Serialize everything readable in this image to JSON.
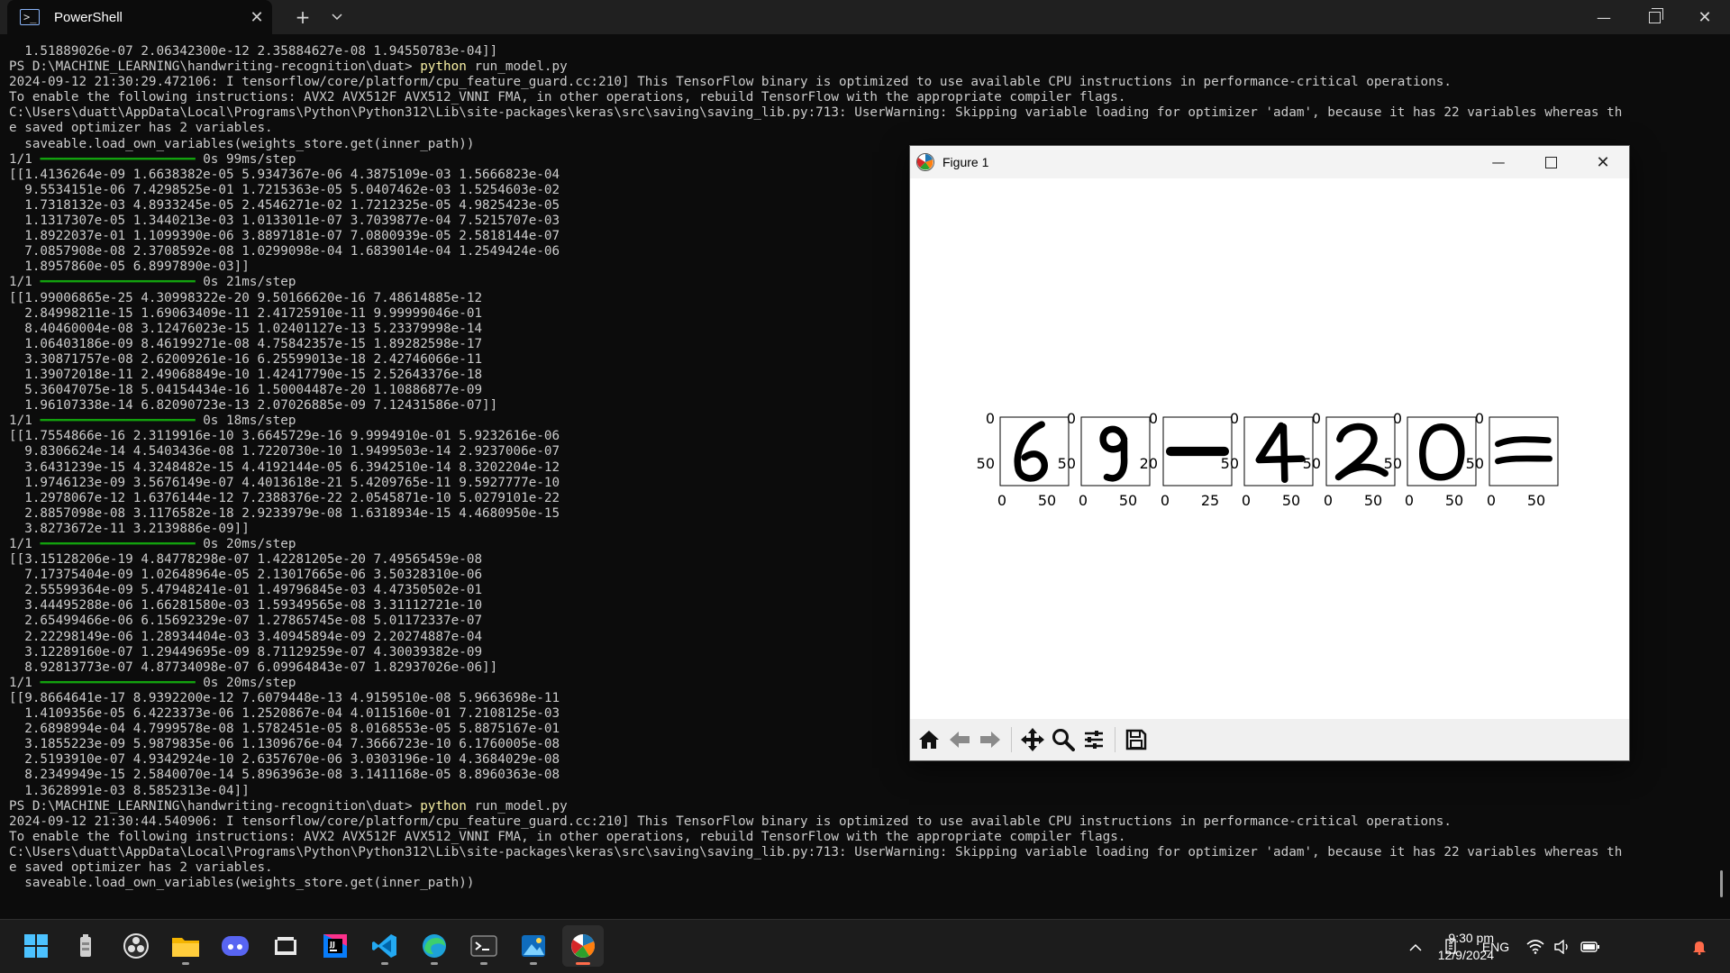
{
  "terminal": {
    "tab_title": "PowerShell",
    "tab_icon": "powershell-icon",
    "new_tab_label": "+",
    "dropdown_label": "⌄",
    "lines": [
      {
        "t": "  1.51889026e-07 2.06342300e-12 2.35884627e-08 1.94550783e-04]]"
      },
      {
        "t": "PS D:\\MACHINE_LEARNING\\handwriting-recognition\\duat> ",
        "cmd": "python",
        "rest": " run_model.py"
      },
      {
        "t": "2024-09-12 21:30:29.472106: I tensorflow/core/platform/cpu_feature_guard.cc:210] This TensorFlow binary is optimized to use available CPU instructions in performance-critical operations."
      },
      {
        "t": "To enable the following instructions: AVX2 AVX512F AVX512_VNNI FMA, in other operations, rebuild TensorFlow with the appropriate compiler flags."
      },
      {
        "t": "C:\\Users\\duatt\\AppData\\Local\\Programs\\Python\\Python312\\Lib\\site-packages\\keras\\src\\saving\\saving_lib.py:713: UserWarning: Skipping variable loading for optimizer 'adam', because it has 22 variables whereas th"
      },
      {
        "t": "e saved optimizer has 2 variables."
      },
      {
        "t": "  saveable.load_own_variables(weights_store.get(inner_path))"
      },
      {
        "t": "1/1 ",
        "bar": "━━━━━━━━━━━━━━━━━━━━",
        "rest": " 0s 99ms/step"
      },
      {
        "t": "[[1.4136264e-09 1.6638382e-05 5.9347367e-06 4.3875109e-03 1.5666823e-04"
      },
      {
        "t": "  9.5534151e-06 7.4298525e-01 1.7215363e-05 5.0407462e-03 1.5254603e-02"
      },
      {
        "t": "  1.7318132e-03 4.8933245e-05 2.4546271e-02 1.7212325e-05 4.9825423e-05"
      },
      {
        "t": "  1.1317307e-05 1.3440213e-03 1.0133011e-07 3.7039877e-04 7.5215707e-03"
      },
      {
        "t": "  1.8922037e-01 1.1099390e-06 3.8897181e-07 7.0800939e-05 2.5818144e-07"
      },
      {
        "t": "  7.0857908e-08 2.3708592e-08 1.0299098e-04 1.6839014e-04 1.2549424e-06"
      },
      {
        "t": "  1.8957860e-05 6.8997890e-03]]"
      },
      {
        "t": "1/1 ",
        "bar": "━━━━━━━━━━━━━━━━━━━━",
        "rest": " 0s 21ms/step"
      },
      {
        "t": "[[1.99006865e-25 4.30998322e-20 9.50166620e-16 7.48614885e-12"
      },
      {
        "t": "  2.84998211e-15 1.69063409e-11 2.41725910e-11 9.99999046e-01"
      },
      {
        "t": "  8.40460004e-08 3.12476023e-15 1.02401127e-13 5.23379998e-14"
      },
      {
        "t": "  1.06403186e-09 8.46199271e-08 4.75842357e-15 1.89282598e-17"
      },
      {
        "t": "  3.30871757e-08 2.62009261e-16 6.25599013e-18 2.42746066e-11"
      },
      {
        "t": "  1.39072018e-11 2.49068849e-10 1.42417790e-15 2.52643376e-18"
      },
      {
        "t": "  5.36047075e-18 5.04154434e-16 1.50004487e-20 1.10886877e-09"
      },
      {
        "t": "  1.96107338e-14 6.82090723e-13 2.07026885e-09 7.12431586e-07]]"
      },
      {
        "t": "1/1 ",
        "bar": "━━━━━━━━━━━━━━━━━━━━",
        "rest": " 0s 18ms/step"
      },
      {
        "t": "[[1.7554866e-16 2.3119916e-10 3.6645729e-16 9.9994910e-01 5.9232616e-06"
      },
      {
        "t": "  9.8306624e-14 4.5403436e-08 1.7220730e-10 1.9499503e-14 2.9237006e-07"
      },
      {
        "t": "  3.6431239e-15 4.3248482e-15 4.4192144e-05 6.3942510e-14 8.3202204e-12"
      },
      {
        "t": "  1.9746123e-09 3.5676149e-07 4.4013618e-21 5.4209765e-11 9.5927777e-10"
      },
      {
        "t": "  1.2978067e-12 1.6376144e-12 7.2388376e-22 2.0545871e-10 5.0279101e-22"
      },
      {
        "t": "  2.8857098e-08 3.1176582e-18 2.9233979e-08 1.6318934e-15 4.4680950e-15"
      },
      {
        "t": "  3.8273672e-11 3.2139886e-09]]"
      },
      {
        "t": "1/1 ",
        "bar": "━━━━━━━━━━━━━━━━━━━━",
        "rest": " 0s 20ms/step"
      },
      {
        "t": "[[3.15128206e-19 4.84778298e-07 1.42281205e-20 7.49565459e-08"
      },
      {
        "t": "  7.17375404e-09 1.02648964e-05 2.13017665e-06 3.50328310e-06"
      },
      {
        "t": "  2.55599364e-09 5.47948241e-01 1.49796845e-03 4.47350502e-01"
      },
      {
        "t": "  3.44495288e-06 1.66281580e-03 1.59349565e-08 3.31112721e-10"
      },
      {
        "t": "  2.65499466e-06 6.15692329e-07 1.27865745e-08 5.01172337e-07"
      },
      {
        "t": "  2.22298149e-06 1.28934404e-03 3.40945894e-09 2.20274887e-04"
      },
      {
        "t": "  3.12289160e-07 1.29449695e-09 8.71129259e-07 4.30039382e-09"
      },
      {
        "t": "  8.92813773e-07 4.87734098e-07 6.09964843e-07 1.82937026e-06]]"
      },
      {
        "t": "1/1 ",
        "bar": "━━━━━━━━━━━━━━━━━━━━",
        "rest": " 0s 20ms/step"
      },
      {
        "t": "[[9.8664641e-17 8.9392200e-12 7.6079448e-13 4.9159510e-08 5.9663698e-11"
      },
      {
        "t": "  1.4109356e-05 6.4223373e-06 1.2520867e-04 4.0115160e-01 7.2108125e-03"
      },
      {
        "t": "  2.6898994e-04 4.7999578e-08 1.5782451e-05 8.0168553e-05 5.8875167e-01"
      },
      {
        "t": "  3.1855223e-09 5.9879835e-06 1.1309676e-04 7.3666723e-10 6.1760005e-08"
      },
      {
        "t": "  2.5193910e-07 4.9342924e-10 2.6357670e-06 3.0303196e-10 4.3684029e-08"
      },
      {
        "t": "  8.2349949e-15 2.5840070e-14 5.8963963e-08 3.1411168e-05 8.8960363e-08"
      },
      {
        "t": "  1.3628991e-03 8.5852313e-04]]"
      },
      {
        "t": "PS D:\\MACHINE_LEARNING\\handwriting-recognition\\duat> ",
        "cmd": "python",
        "rest": " run_model.py"
      },
      {
        "t": "2024-09-12 21:30:44.540906: I tensorflow/core/platform/cpu_feature_guard.cc:210] This TensorFlow binary is optimized to use available CPU instructions in performance-critical operations."
      },
      {
        "t": "To enable the following instructions: AVX2 AVX512F AVX512_VNNI FMA, in other operations, rebuild TensorFlow with the appropriate compiler flags."
      },
      {
        "t": "C:\\Users\\duatt\\AppData\\Local\\Programs\\Python\\Python312\\Lib\\site-packages\\keras\\src\\saving\\saving_lib.py:713: UserWarning: Skipping variable loading for optimizer 'adam', because it has 22 variables whereas th"
      },
      {
        "t": "e saved optimizer has 2 variables."
      },
      {
        "t": "  saveable.load_own_variables(weights_store.get(inner_path))"
      }
    ],
    "colors": {
      "background": "#0c0c0c",
      "text": "#cccccc",
      "command": "#f9f1a5",
      "progress": "#13a10e"
    }
  },
  "figure_window": {
    "title": "Figure 1",
    "icon": "matplotlib-icon",
    "panels": [
      {
        "glyph": "6",
        "y_ticks": [
          "0",
          "50"
        ],
        "x_ticks": [
          "0",
          "50"
        ]
      },
      {
        "glyph": "9",
        "y_ticks": [
          "0",
          "50"
        ],
        "x_ticks": [
          "0",
          "50"
        ]
      },
      {
        "glyph": "—",
        "y_ticks": [
          "0",
          "20"
        ],
        "x_ticks": [
          "0",
          "25"
        ]
      },
      {
        "glyph": "4",
        "y_ticks": [
          "0",
          "50"
        ],
        "x_ticks": [
          "0",
          "50"
        ]
      },
      {
        "glyph": "2",
        "y_ticks": [
          "0",
          "50"
        ],
        "x_ticks": [
          "0",
          "50"
        ]
      },
      {
        "glyph": "0",
        "y_ticks": [
          "0",
          "50"
        ],
        "x_ticks": [
          "0",
          "50"
        ]
      },
      {
        "glyph": "=",
        "y_ticks": [
          "0",
          "50"
        ],
        "x_ticks": [
          "0",
          "50"
        ]
      }
    ],
    "toolbar": [
      {
        "name": "home-icon"
      },
      {
        "name": "back-arrow-icon"
      },
      {
        "name": "forward-arrow-icon"
      },
      {
        "name": "pan-icon"
      },
      {
        "name": "zoom-icon"
      },
      {
        "name": "configure-subplots-icon"
      },
      {
        "name": "save-icon"
      }
    ]
  },
  "taskbar": {
    "apps": [
      {
        "name": "start-button",
        "icon": "windows-logo-icon",
        "active": false,
        "running": false
      },
      {
        "name": "taskbar-app-battery-tool",
        "icon": "battery-tool-icon",
        "active": false,
        "running": false
      },
      {
        "name": "taskbar-app-obs",
        "icon": "obs-icon",
        "active": false,
        "running": false
      },
      {
        "name": "taskbar-app-file-explorer",
        "icon": "folder-icon",
        "active": false,
        "running": true
      },
      {
        "name": "taskbar-app-discord",
        "icon": "discord-icon",
        "active": false,
        "running": false
      },
      {
        "name": "taskbar-app-video-editor",
        "icon": "clapperboard-icon",
        "active": false,
        "running": false
      },
      {
        "name": "taskbar-app-jetbrains",
        "icon": "jetbrains-icon",
        "active": false,
        "running": false
      },
      {
        "name": "taskbar-app-vscode",
        "icon": "vscode-icon",
        "active": false,
        "running": true
      },
      {
        "name": "taskbar-app-edge",
        "icon": "edge-icon",
        "active": false,
        "running": true
      },
      {
        "name": "taskbar-app-terminal",
        "icon": "terminal-icon",
        "active": false,
        "running": true
      },
      {
        "name": "taskbar-app-photos",
        "icon": "photos-icon",
        "active": false,
        "running": true
      },
      {
        "name": "taskbar-app-python-figure",
        "icon": "matplotlib-icon",
        "active": true,
        "running": true
      }
    ],
    "language": "ENG",
    "time": "9:30 pm",
    "date": "12/9/2024",
    "accent": "#ff6b4a"
  }
}
